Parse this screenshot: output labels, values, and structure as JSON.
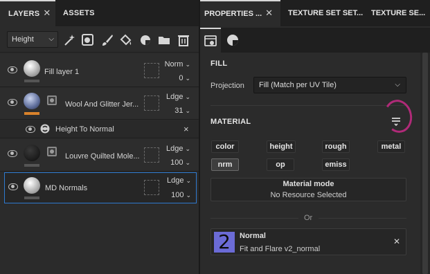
{
  "left_panel": {
    "tabs": [
      {
        "label": "LAYERS",
        "close": "✕"
      },
      {
        "label": "ASSETS"
      }
    ],
    "channel_select": "Height",
    "layers": [
      {
        "name": "Fill layer 1",
        "blend": "Norm",
        "opacity": "0",
        "thumb_color": "#d8d8d8"
      },
      {
        "name": "Wool And Glitter Jer...",
        "blend": "Ldge",
        "opacity": "31",
        "thumb_color": "#6f7ea8"
      },
      {
        "name": "Louvre Quilted Mole...",
        "blend": "Ldge",
        "opacity": "100",
        "thumb_color": "#1c1c1c"
      },
      {
        "name": "MD Normals",
        "blend": "Ldge",
        "opacity": "100",
        "thumb_color": "#e0e0e0"
      }
    ],
    "effect": {
      "name": "Height To Normal",
      "close": "×"
    }
  },
  "right_panel": {
    "tabs": [
      "PROPERTIES ...",
      "TEXTURE SET SET...",
      "TEXTURE SE..."
    ],
    "tab_close": "✕",
    "fill": {
      "title": "FILL",
      "projection_label": "Projection",
      "projection_value": "Fill (Match per UV Tile)"
    },
    "material": {
      "title": "MATERIAL",
      "channels_row1": [
        "color",
        "height",
        "rough",
        "metal"
      ],
      "channels_row2": [
        "nrm",
        "op",
        "emiss"
      ],
      "mode_title": "Material mode",
      "mode_value": "No Resource Selected",
      "or_text": "Or",
      "resource": {
        "badge": "2",
        "title": "Normal",
        "subtitle": "Fit and Flare v2_normal",
        "close": "✕"
      }
    }
  },
  "colors": {
    "selection": "#2e7ad1",
    "badge": "#6b6bd6",
    "annotation": "#b02a78",
    "accent_orange": "#d9822b"
  }
}
